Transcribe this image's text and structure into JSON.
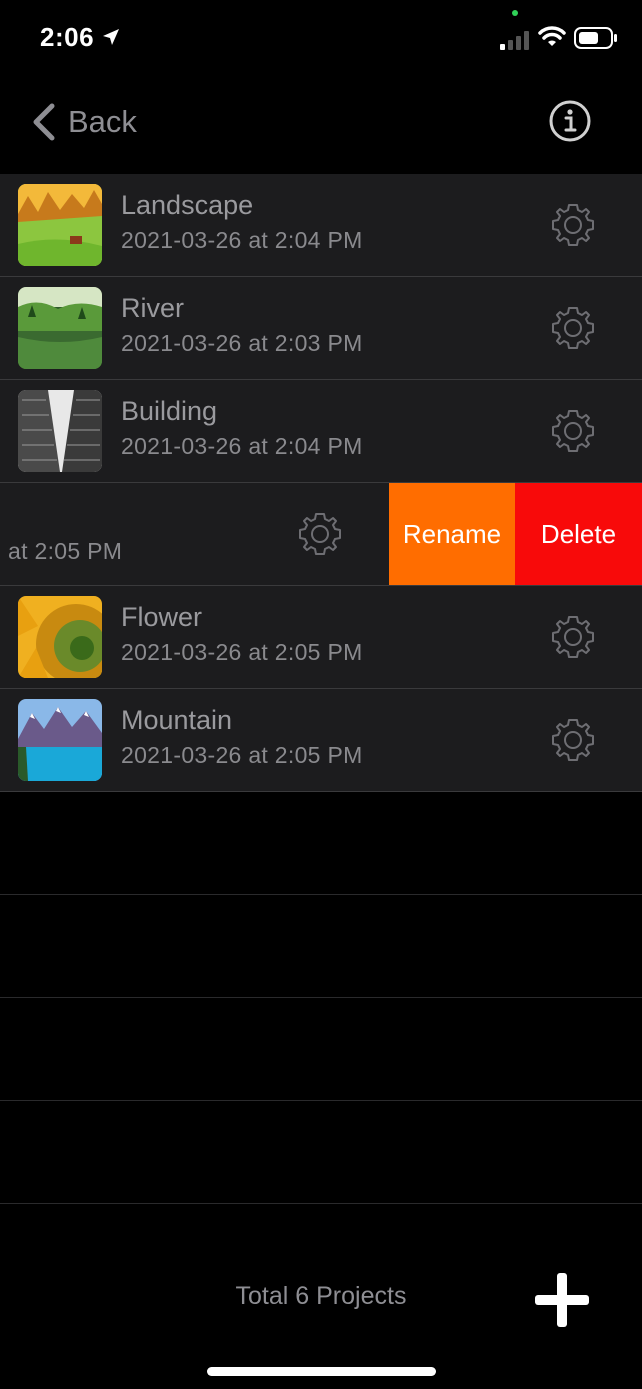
{
  "status": {
    "time": "2:06"
  },
  "nav": {
    "back_label": "Back"
  },
  "projects": [
    {
      "title": "Landscape",
      "date": "2021-03-26 at 2:04 PM",
      "thumb": "landscape-thumbnail"
    },
    {
      "title": "River",
      "date": "2021-03-26 at 2:03 PM",
      "thumb": "river-thumbnail"
    },
    {
      "title": "Building",
      "date": "2021-03-26 at 2:04 PM",
      "thumb": "building-thumbnail"
    },
    {
      "title": "",
      "date": "at 2:05 PM",
      "swiped": true
    },
    {
      "title": "Flower",
      "date": "2021-03-26 at 2:05 PM",
      "thumb": "flower-thumbnail"
    },
    {
      "title": "Mountain",
      "date": "2021-03-26 at 2:05 PM",
      "thumb": "mountain-thumbnail"
    }
  ],
  "swipe_actions": {
    "rename_label": "Rename",
    "delete_label": "Delete",
    "rename_color": "#ff6d00",
    "delete_color": "#f80a0a"
  },
  "footer": {
    "count_label": "Total 6 Projects"
  },
  "icons": {
    "back": "chevron-left-icon",
    "info": "info-circle-icon",
    "settings": "gear-icon",
    "add": "plus-icon"
  }
}
